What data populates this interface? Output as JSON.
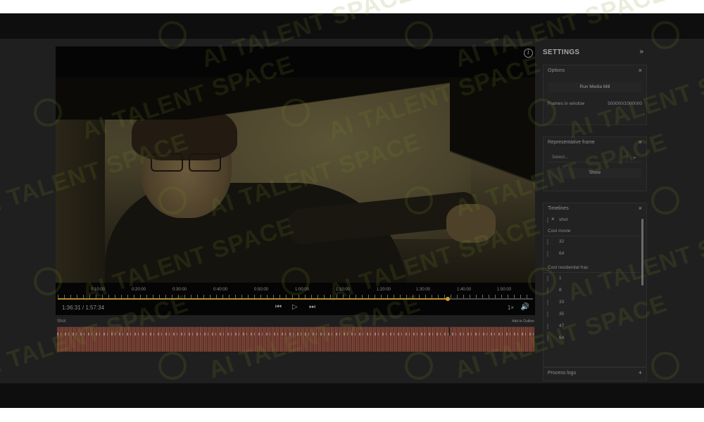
{
  "player": {
    "info_icon": "info-icon",
    "tick_labels": [
      "0:10:00",
      "0:20:00",
      "0:30:00",
      "0:40:00",
      "0:50:00",
      "1:00:00",
      "1:10:00",
      "1:20:00",
      "1:30:00",
      "1:40:00",
      "1:50:00"
    ],
    "progress": 0.82,
    "timecode": "1:36:31 / 1:57:34",
    "prev_icon": "skip-back-icon",
    "play_icon": "play-icon",
    "next_icon": "skip-forward-icon",
    "speed": "1×",
    "volume_icon": "volume-icon"
  },
  "timeline_strip": {
    "label": "Shot",
    "right_label": "Add to Outline"
  },
  "settings": {
    "title": "SETTINGS",
    "collapse_icon": "»",
    "options": {
      "title": "Options",
      "run_button": "Run Media Mill",
      "frames_label": "Frames in window",
      "frames_value": "500000/1000000"
    },
    "representative": {
      "title": "Representative frame",
      "select_placeholder": "Select...",
      "show_button": "Show"
    },
    "timelines": {
      "title": "Timelines",
      "shot_item": "shot",
      "group1": "Cost movie",
      "group1_items": [
        "32",
        "64"
      ],
      "group2": "Cost residential frac",
      "group2_items": [
        "1",
        "8",
        "33",
        "35",
        "47",
        "64"
      ]
    },
    "process_logs": {
      "title": "Process logs",
      "add_icon": "+"
    }
  },
  "watermark": "AI TALENT SPACE"
}
